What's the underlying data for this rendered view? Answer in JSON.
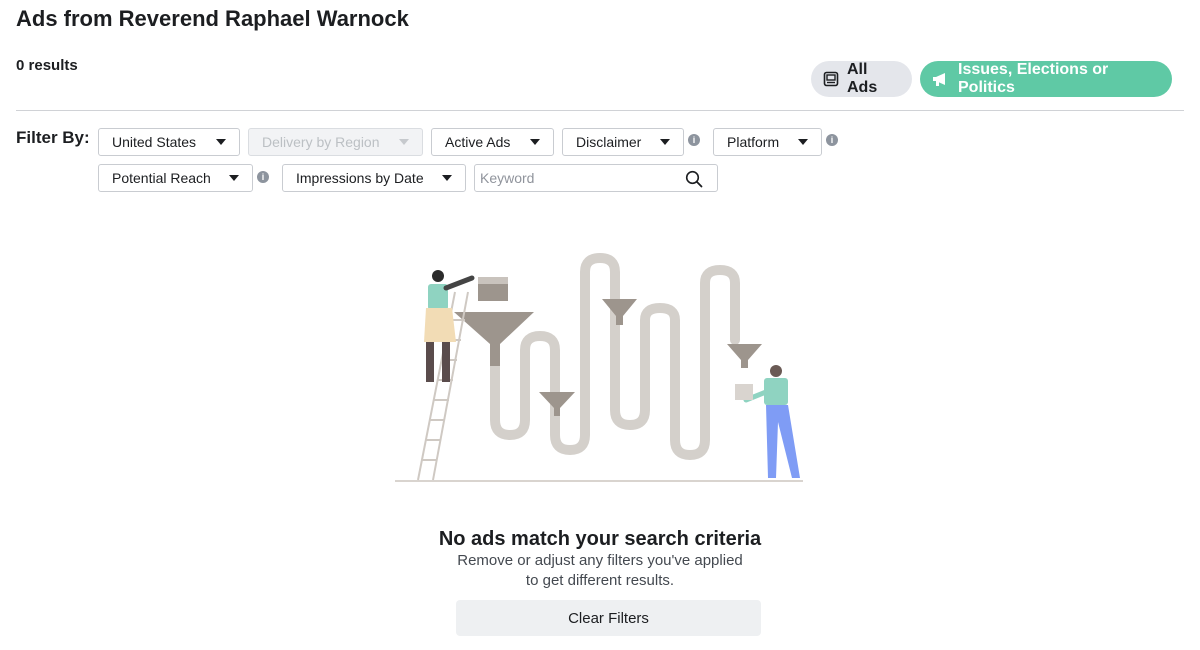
{
  "header": {
    "title": "Ads from Reverend Raphael Warnock",
    "results": "0 results"
  },
  "tabs": {
    "all_ads": "All Ads",
    "issues": "Issues, Elections or Politics"
  },
  "filters": {
    "label": "Filter By:",
    "country": "United States",
    "delivery": "Delivery by Region",
    "status": "Active Ads",
    "disclaimer": "Disclaimer",
    "platform": "Platform",
    "reach": "Potential Reach",
    "impressions": "Impressions by Date",
    "keyword_placeholder": "Keyword",
    "info_glyph": "i"
  },
  "empty": {
    "title": "No ads match your search criteria",
    "description": "Remove or adjust any filters you've applied to get different results.",
    "clear_label": "Clear Filters"
  },
  "colors": {
    "accent": "#5fc9a5",
    "pill_bg": "#e4e6eb",
    "pipe": "#d4d0cb",
    "funnel": "#9d958d"
  }
}
